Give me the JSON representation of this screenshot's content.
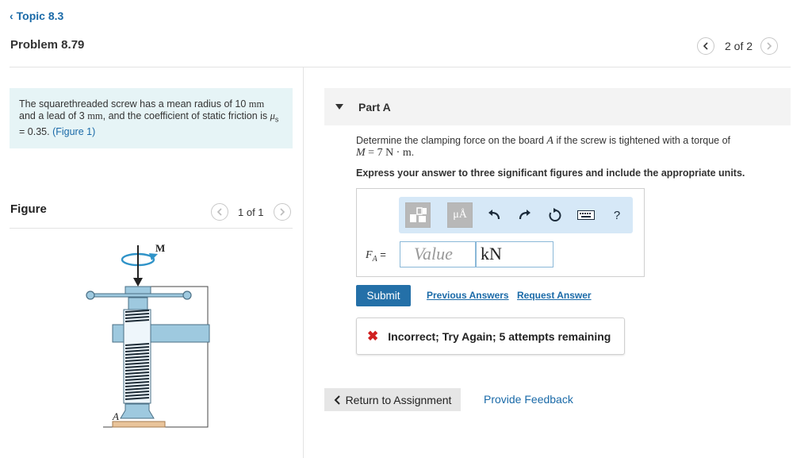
{
  "nav": {
    "topic_label": "Topic 8.3"
  },
  "header": {
    "problem_title": "Problem 8.79",
    "pager_text": "2 of 2"
  },
  "problem": {
    "text_1": "The squarethreaded screw has a mean radius of 10 ",
    "unit_mm_1": "mm",
    "text_2": " and a lead of 3 ",
    "unit_mm_2": "mm",
    "text_3": ", and the coefficient of static friction is ",
    "mu_symbol": "μ",
    "mu_sub": "s",
    "text_4": " = 0.35. ",
    "figure_link": "(Figure 1)"
  },
  "figure": {
    "title": "Figure",
    "pager_text": "1 of 1",
    "label_M": "M",
    "label_A": "A"
  },
  "part": {
    "label": "Part A",
    "question_1": "Determine the clamping force on the board ",
    "question_A": "A",
    "question_2": " if the screw is tightened with a torque of ",
    "question_M": "M",
    "question_3": " = 7  N · m",
    "question_4": ".",
    "instruction": "Express your answer to three significant figures and include the appropriate units."
  },
  "toolbar": {
    "templates_icon": "templates-icon",
    "units_button_label": "μÅ",
    "undo_icon": "undo-icon",
    "redo_icon": "redo-icon",
    "reset_icon": "reset-icon",
    "keyboard_icon": "keyboard-icon",
    "help_label": "?"
  },
  "answer": {
    "variable": "F",
    "variable_sub": "A",
    "equals": " =",
    "value_placeholder": "Value",
    "unit_value": "kN"
  },
  "actions": {
    "submit_label": "Submit",
    "previous_answers_label": "Previous Answers",
    "request_answer_label": "Request Answer"
  },
  "feedback": {
    "icon": "x-icon",
    "message": "Incorrect; Try Again; 5 attempts remaining"
  },
  "footer": {
    "return_label": "Return to Assignment",
    "provide_feedback_label": "Provide Feedback"
  },
  "colors": {
    "link": "#1a6aa8",
    "submit_bg": "#2470a8",
    "problem_box_bg": "#e6f4f6",
    "toolbar_bg": "#d6e8f7",
    "error": "#d01f1f",
    "clamp_blue": "#9ec9df"
  }
}
